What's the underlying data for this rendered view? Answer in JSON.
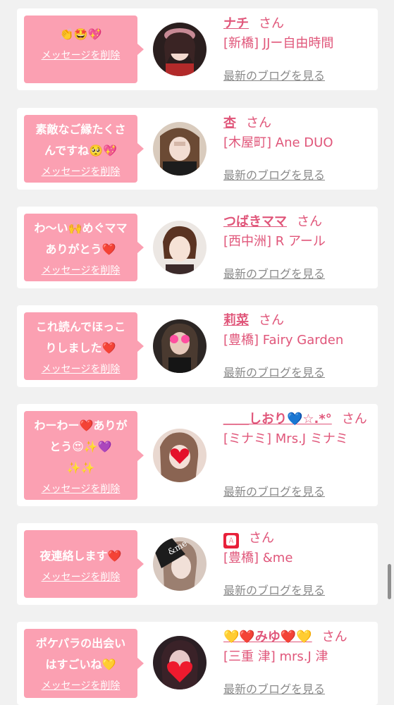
{
  "colors": {
    "bubble": "#fba0b2",
    "accent": "#e0567a",
    "blog_link": "#8a8a8a",
    "card": "#ffffff",
    "page_bg": "#f1f1f1"
  },
  "messages": [
    {
      "message": "👏🤩💖",
      "delete_label": "メッセージを削除",
      "name": "ナチ",
      "honorific": "さん",
      "shop": "[新橋] JJー自由時間",
      "blog_label": "最新のブログを見る"
    },
    {
      "message": "素敵なご縁たくさ\nんですね🥺💖",
      "delete_label": "メッセージを削除",
      "name": "杏",
      "honorific": "さん",
      "shop": "[木屋町] Ane DUO",
      "blog_label": "最新のブログを見る"
    },
    {
      "message": "わ〜い🙌めぐママ\nありがとう❤️",
      "delete_label": "メッセージを削除",
      "name": "つばきママ",
      "honorific": "さん",
      "shop": "[西中洲] R アール",
      "blog_label": "最新のブログを見る"
    },
    {
      "message": "これ読んでほっこ\nりしました❤️",
      "delete_label": "メッセージを削除",
      "name": "莉菜",
      "honorific": "さん",
      "shop": "[豊橋] Fairy Garden",
      "blog_label": "最新のブログを見る"
    },
    {
      "message": "わーわー❤️ありが\nとう😍✨💜\n✨✨",
      "delete_label": "メッセージを削除",
      "name": "＿＿しおり💙☆.*°",
      "honorific": "さん",
      "shop": "[ミナミ] Mrs.J ミナミ",
      "blog_label": "最新のブログを見る"
    },
    {
      "message": "夜連絡します❤️",
      "delete_label": "メッセージを削除",
      "name": "🅰",
      "honorific": "さん",
      "shop": "[豊橋] &me",
      "blog_label": "最新のブログを見る"
    },
    {
      "message": "ポケパラの出会い\nはすごいね💛",
      "delete_label": "メッセージを削除",
      "name": "💛❤️みゆ❤️💛",
      "honorific": "さん",
      "shop": "[三重 津] mrs.J 津",
      "blog_label": "最新のブログを見る"
    }
  ],
  "avatar_badge_text": "&me"
}
